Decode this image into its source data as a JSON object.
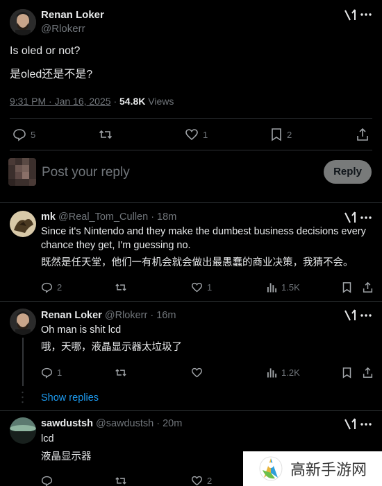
{
  "main_post": {
    "author_name": "Renan Loker",
    "author_handle": "@Rlokerr",
    "text_en": "Is oled or not?",
    "text_zh": "是oled还是不是?",
    "timestamp": "9:31 PM · Jan 16, 2025",
    "views_count": "54.8K",
    "views_label": "Views",
    "replies": "5",
    "likes": "1",
    "bookmarks": "2"
  },
  "reply_box": {
    "placeholder": "Post your reply",
    "button_label": "Reply"
  },
  "replies": [
    {
      "author_name": "mk",
      "author_handle": "@Real_Tom_Cullen",
      "time": "· 18m",
      "text_en": "Since it's Nintendo and they make the dumbest business decisions every chance they get, I'm guessing no.",
      "text_zh": "既然是任天堂，他们一有机会就会做出最愚蠢的商业决策，我猜不会。",
      "replies": "2",
      "likes": "1",
      "views": "1.5K"
    },
    {
      "author_name": "Renan Loker",
      "author_handle": "@Rlokerr",
      "time": "· 16m",
      "text_en": "Oh man is shit lcd",
      "text_zh": "哦，天哪，液晶显示器太垃圾了",
      "replies": "1",
      "likes": "",
      "views": "1.2K"
    },
    {
      "author_name": "sawdustsh",
      "author_handle": "@sawdustsh",
      "time": "· 20m",
      "text_en": "lcd",
      "text_zh": "液晶显示器",
      "replies": "",
      "likes": "2"
    }
  ],
  "show_replies": "Show replies",
  "watermark": {
    "text": "高新手游网"
  },
  "colors": {
    "background": "#000000",
    "text": "#e7e9ea",
    "muted": "#71767b",
    "link": "#1d9bf0",
    "divider": "#2f3336",
    "reply_button_bg": "#787a7a"
  }
}
